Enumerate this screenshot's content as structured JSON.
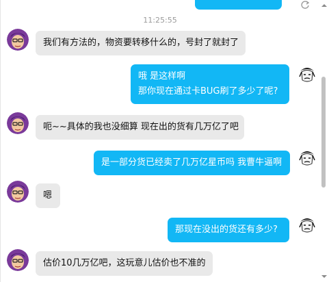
{
  "timestamp": "11:25:55",
  "messages": [
    {
      "side": "in",
      "lines": [
        "我们有方法的，物资要转移什么的，号封了就封了"
      ]
    },
    {
      "side": "out",
      "lines": [
        "哦 是这样啊",
        "那你现在通过卡BUG刷了多少了呢?"
      ]
    },
    {
      "side": "in",
      "lines": [
        "呃~~具体的我也没细算 现在出的货有几万亿了吧"
      ]
    },
    {
      "side": "out",
      "lines": [
        "是一部分货已经卖了几万亿星币吗 我曹牛逼啊"
      ]
    },
    {
      "side": "in",
      "lines": [
        "嗯"
      ]
    },
    {
      "side": "out",
      "lines": [
        "那现在没出的货还有多少?"
      ]
    },
    {
      "side": "in",
      "lines": [
        "估价10几万亿吧，这玩意儿估价也不准的"
      ]
    }
  ],
  "colors": {
    "out_bubble": "#12b7f5",
    "in_bubble": "#e9e9e9",
    "timestamp": "#9a9a9a"
  },
  "icons": {
    "contact_avatar": "cartoon-avatar-icon",
    "user_avatar": "bw-cartoon-avatar-icon",
    "resend": "refresh-icon"
  }
}
